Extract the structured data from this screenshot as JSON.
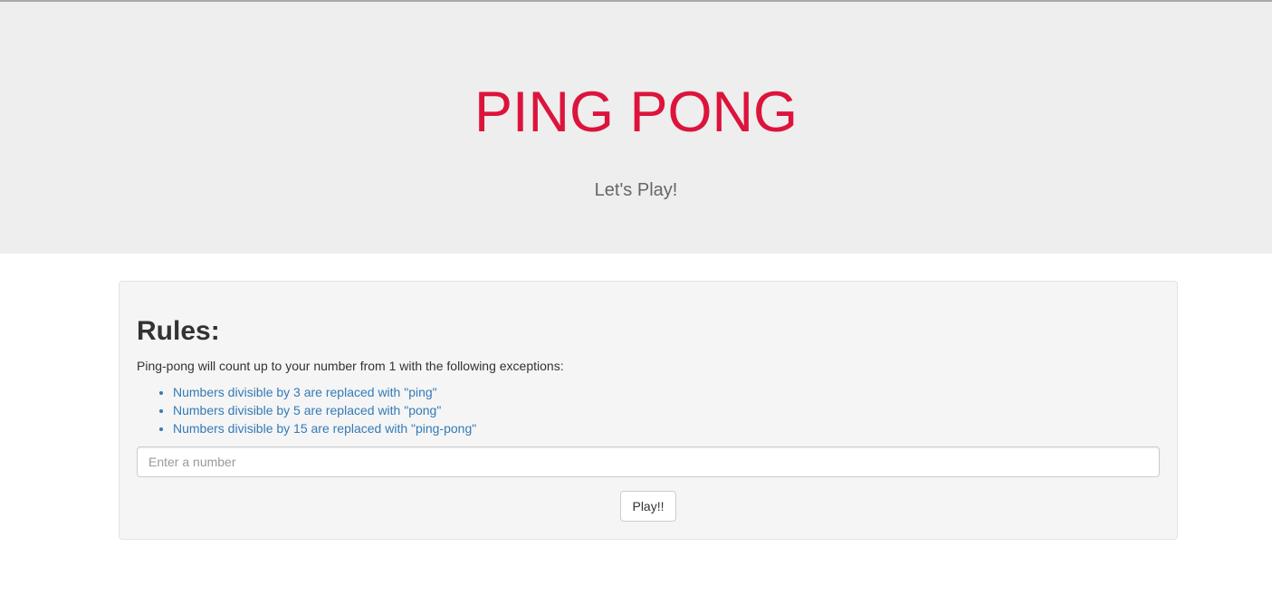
{
  "header": {
    "title": "PING PONG",
    "subtitle": "Let's Play!",
    "title_color": "#dc143c",
    "background": "#eeeeee"
  },
  "rules": {
    "heading": "Rules:",
    "intro": "Ping-pong will count up to your number from 1 with the following exceptions:",
    "items": [
      {
        "label": "Numbers divisible by 3 are replaced with \"ping\""
      },
      {
        "label": "Numbers divisible by 5 are replaced with \"pong\""
      },
      {
        "label": "Numbers divisible by 15 are replaced with \"ping-pong\""
      }
    ],
    "list_color": "#337ab7"
  },
  "form": {
    "number_value": "",
    "number_placeholder": "Enter a number",
    "play_label": "Play!!"
  }
}
